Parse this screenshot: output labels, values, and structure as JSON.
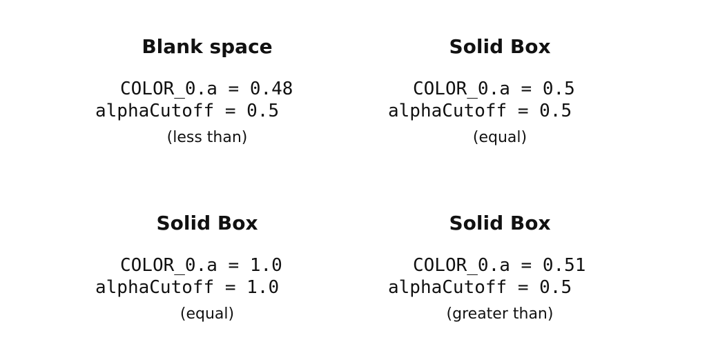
{
  "panels": [
    {
      "title": "Blank space",
      "color_line": "COLOR_0.a = 0.48",
      "cutoff_line": "alphaCutoff = 0.5",
      "note": "(less than)"
    },
    {
      "title": "Solid Box",
      "color_line": "COLOR_0.a = 0.5",
      "cutoff_line": "alphaCutoff = 0.5",
      "note": "(equal)"
    },
    {
      "title": "Solid Box",
      "color_line": "COLOR_0.a = 1.0",
      "cutoff_line": "alphaCutoff = 1.0",
      "note": "(equal)"
    },
    {
      "title": "Solid Box",
      "color_line": "COLOR_0.a = 0.51",
      "cutoff_line": "alphaCutoff = 0.5",
      "note": "(greater than)"
    }
  ]
}
